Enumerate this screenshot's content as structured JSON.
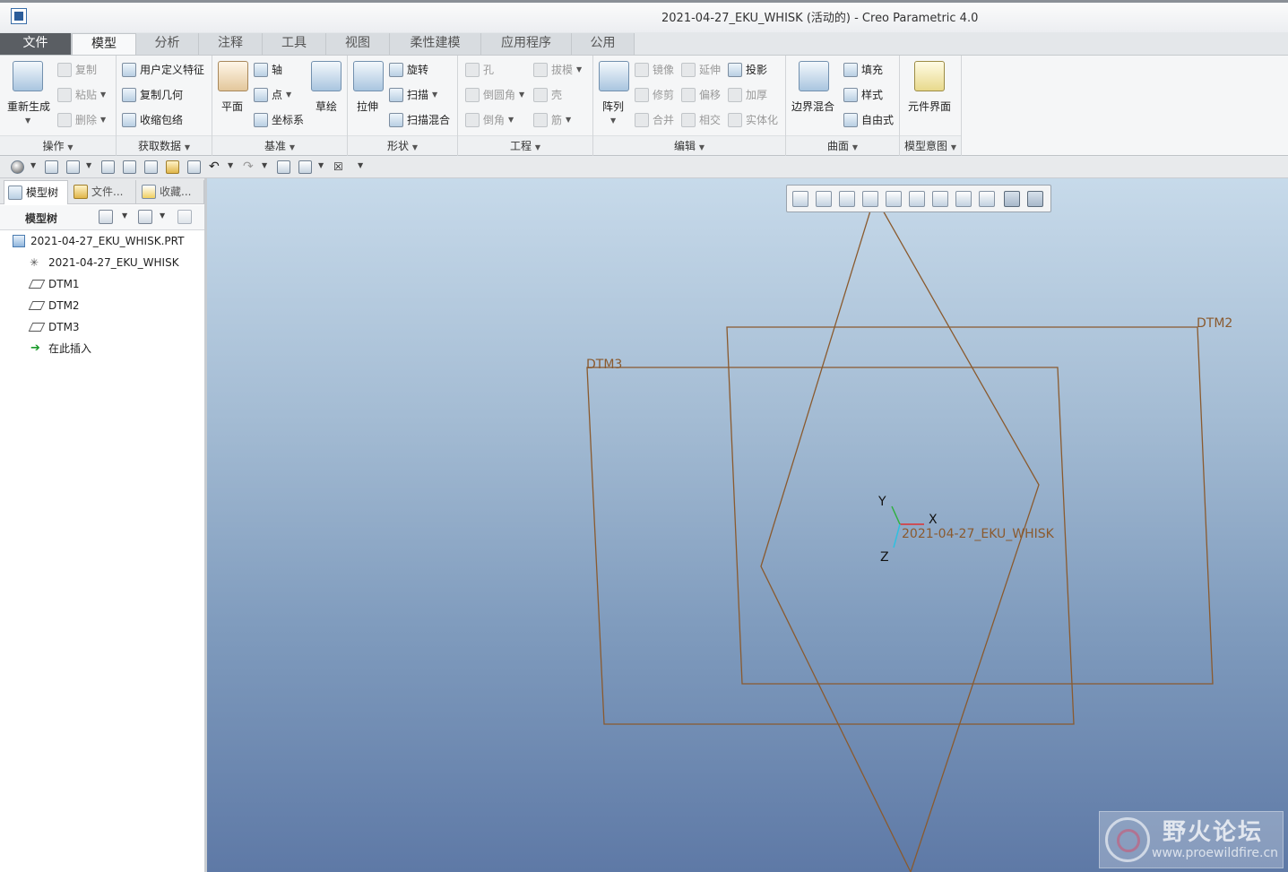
{
  "window": {
    "title": "2021-04-27_EKU_WHISK (活动的) - Creo Parametric 4.0"
  },
  "tabs": [
    "文件",
    "模型",
    "分析",
    "注释",
    "工具",
    "视图",
    "柔性建模",
    "应用程序",
    "公用"
  ],
  "ribbon": {
    "operations": {
      "label": "操作",
      "regenerate": "重新生成",
      "copy": "复制",
      "paste": "粘贴",
      "delete": "删除"
    },
    "get_data": {
      "label": "获取数据",
      "udf": "用户定义特征",
      "copy_geom": "复制几何",
      "shrinkwrap": "收缩包络"
    },
    "datum": {
      "label": "基准",
      "plane": "平面",
      "axis": "轴",
      "point": "点",
      "csys": "坐标系",
      "sketch": "草绘"
    },
    "shapes": {
      "label": "形状",
      "extrude": "拉伸",
      "revolve": "旋转",
      "sweep": "扫描",
      "swept_blend": "扫描混合"
    },
    "engineering": {
      "label": "工程",
      "hole": "孔",
      "draft": "拔模",
      "round": "倒圆角",
      "shell": "壳",
      "chamfer": "倒角",
      "rib": "筋"
    },
    "editing": {
      "label": "编辑",
      "pattern": "阵列",
      "mirror": "镜像",
      "extend": "延伸",
      "project": "投影",
      "trim": "修剪",
      "offset": "偏移",
      "thicken": "加厚",
      "merge": "合并",
      "intersect": "相交",
      "solidify": "实体化"
    },
    "surfaces": {
      "label": "曲面",
      "boundary_blend": "边界混合",
      "fill": "填充",
      "style": "样式",
      "freestyle": "自由式"
    },
    "model_intent": {
      "label": "模型意图",
      "component_interface": "元件界面"
    }
  },
  "panel": {
    "tabs": [
      "模型树",
      "文件...",
      "收藏..."
    ],
    "tree_title": "模型树",
    "items": [
      {
        "label": "2021-04-27_EKU_WHISK.PRT",
        "icon": "part-icon"
      },
      {
        "label": "2021-04-27_EKU_WHISK",
        "icon": "csys-icon"
      },
      {
        "label": "DTM1",
        "icon": "datum-plane-icon"
      },
      {
        "label": "DTM2",
        "icon": "datum-plane-icon"
      },
      {
        "label": "DTM3",
        "icon": "datum-plane-icon"
      },
      {
        "label": "在此插入",
        "icon": "insert-here-arrow-icon"
      }
    ]
  },
  "viewport": {
    "datum_labels": {
      "dtm2": "DTM2",
      "dtm3": "DTM3"
    },
    "csys_label": "2021-04-27_EKU_WHISK",
    "axis_labels": {
      "x": "X",
      "y": "Y",
      "z": "Z"
    },
    "datum_color": "#8a5a2e",
    "csys_x_color": "#e03030",
    "csys_y_color": "#30b040",
    "csys_z_color": "#30c0e0"
  },
  "watermark": {
    "title": "野火论坛",
    "url": "www.proewildfire.cn"
  },
  "colors": {
    "file_tab": "#5a5e63",
    "viewport_top": "#c7daea",
    "viewport_bottom": "#5e79a6"
  }
}
